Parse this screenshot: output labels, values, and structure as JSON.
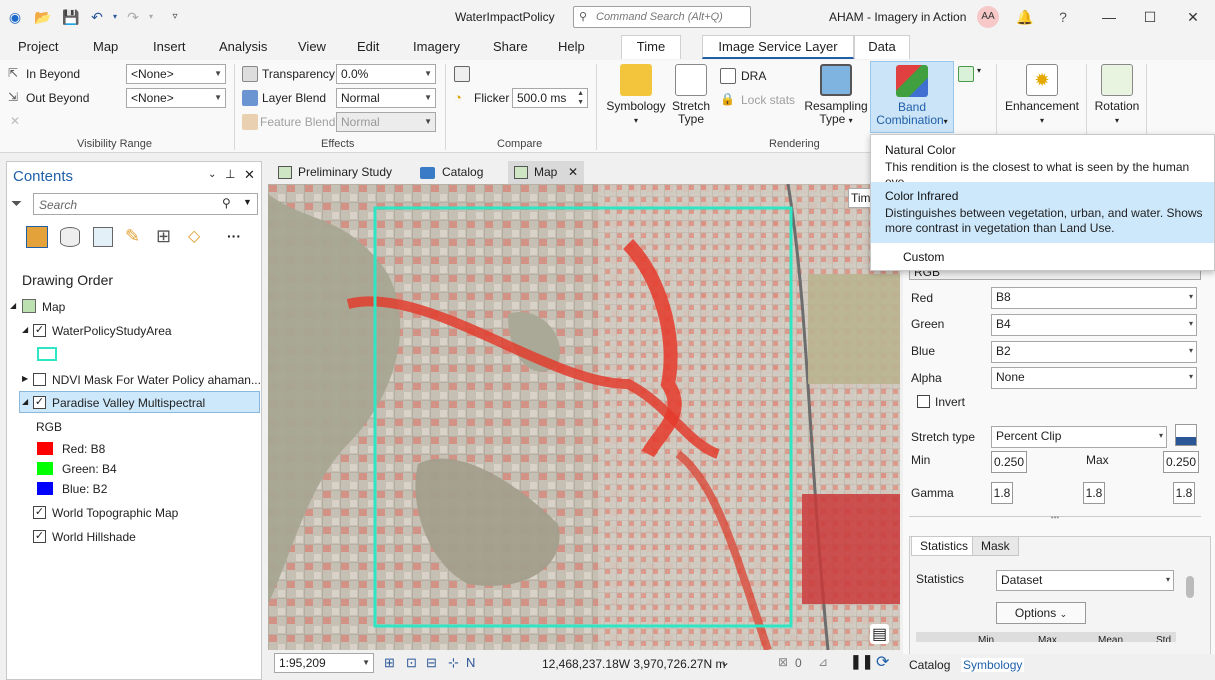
{
  "window": {
    "app_title": "WaterImpactPolicy",
    "command_search_placeholder": "Command Search (Alt+Q)",
    "project_name": "AHAM - Imagery in Action",
    "user_initials": "AA"
  },
  "menu": {
    "tabs": [
      "Project",
      "Map",
      "Insert",
      "Analysis",
      "View",
      "Edit",
      "Imagery",
      "Share",
      "Help"
    ],
    "context_tabs": [
      "Time",
      "Image Service Layer",
      "Data"
    ]
  },
  "ribbon": {
    "visibility_range": {
      "in_beyond_label": "In Beyond",
      "in_beyond_value": "<None>",
      "out_beyond_label": "Out Beyond",
      "out_beyond_value": "<None>",
      "group_label": "Visibility Range"
    },
    "effects": {
      "transparency_label": "Transparency",
      "transparency_value": "0.0%",
      "layer_blend_label": "Layer Blend",
      "layer_blend_value": "Normal",
      "feature_blend_label": "Feature Blend",
      "feature_blend_value": "Normal",
      "group_label": "Effects"
    },
    "compare": {
      "flicker_label": "Flicker",
      "flicker_value": "500.0  ms",
      "group_label": "Compare"
    },
    "rendering": {
      "symbology_label": "Symbology",
      "stretch_type_label_1": "Stretch",
      "stretch_type_label_2": "Type",
      "dra_label": "DRA",
      "lock_stats_label": "Lock stats",
      "resampling_label_1": "Resampling",
      "resampling_label_2": "Type",
      "band_combination_label_1": "Band",
      "band_combination_label_2": "Combination",
      "group_label": "Rendering"
    },
    "enhancement_label": "Enhancement",
    "rotation_label": "Rotation"
  },
  "band_dropdown": {
    "items": [
      {
        "title": "Natural Color",
        "desc": "This rendition is the closest to what is seen by the human eye."
      },
      {
        "title": "Color Infrared",
        "desc": "Distinguishes between vegetation, urban, and water. Shows more contrast in vegetation than Land Use."
      },
      {
        "title": "Custom",
        "desc": ""
      }
    ]
  },
  "contents": {
    "title": "Contents",
    "search_placeholder": "Search",
    "drawing_order": "Drawing Order",
    "map_name": "Map",
    "layers": {
      "study_area": "WaterPolicyStudyArea",
      "ndvi_mask": "NDVI Mask For Water Policy ahaman...",
      "multispectral": "Paradise Valley Multispectral",
      "rgb_label": "RGB",
      "red": "Red:   B8",
      "green": "Green:  B4",
      "blue": "Blue:  B2",
      "topo": "World Topographic Map",
      "hillshade": "World Hillshade"
    },
    "colors": {
      "red": "#ff0000",
      "green": "#00ff00",
      "blue": "#0000ff",
      "study_area_outline": "#2ee6c4"
    }
  },
  "views": {
    "tabs": [
      "Preliminary Study",
      "Catalog",
      "Map"
    ],
    "time_button": "Tim"
  },
  "map_status": {
    "scale": "1:95,209",
    "coordinates": "12,468,237.18W 3,970,726.27N m",
    "selected_count": "0"
  },
  "symbology": {
    "rgb_value": "RGB",
    "red_label": "Red",
    "red_value": "B8",
    "green_label": "Green",
    "green_value": "B4",
    "blue_label": "Blue",
    "blue_value": "B2",
    "alpha_label": "Alpha",
    "alpha_value": "None",
    "invert_label": "Invert",
    "stretch_type_label": "Stretch type",
    "stretch_type_value": "Percent Clip",
    "min_label": "Min",
    "min_value": "0.250",
    "max_label": "Max",
    "max_value": "0.250",
    "gamma_label": "Gamma",
    "gamma_values": [
      "1.8",
      "1.8",
      "1.8"
    ],
    "tabs": [
      "Statistics",
      "Mask"
    ],
    "statistics_label": "Statistics",
    "statistics_value": "Dataset",
    "options_label": "Options",
    "table_headers": [
      "Min",
      "Max",
      "Mean",
      "Std"
    ]
  },
  "bottom_tabs": [
    "Catalog",
    "Symbology"
  ]
}
